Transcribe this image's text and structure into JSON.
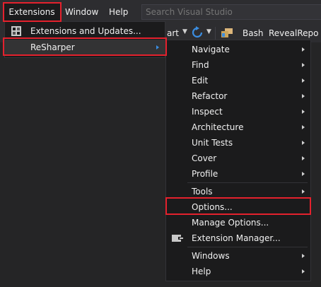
{
  "menubar": {
    "extensions": "Extensions",
    "window": "Window",
    "help": "Help",
    "search_placeholder": "Search Visual Studio"
  },
  "toolbar": {
    "partial_start": "art",
    "bash": "Bash",
    "reveal_repo": "RevealRepo"
  },
  "extensions_menu": {
    "items": [
      {
        "label": "Extensions and Updates...",
        "icon": "extensions-icon"
      },
      {
        "label": "ReSharper",
        "submenu": true
      }
    ]
  },
  "resharper_menu": {
    "items": [
      {
        "label": "Navigate",
        "submenu": true
      },
      {
        "label": "Find",
        "submenu": true
      },
      {
        "label": "Edit",
        "submenu": true
      },
      {
        "label": "Refactor",
        "submenu": true
      },
      {
        "label": "Inspect",
        "submenu": true
      },
      {
        "label": "Architecture",
        "submenu": true
      },
      {
        "label": "Unit Tests",
        "submenu": true
      },
      {
        "label": "Cover",
        "submenu": true
      },
      {
        "label": "Profile",
        "submenu": true
      },
      {
        "label": "Tools",
        "submenu": true
      },
      {
        "label": "Options..."
      },
      {
        "label": "Manage Options..."
      },
      {
        "label": "Extension Manager...",
        "icon": "extension-manager-icon"
      },
      {
        "label": "Windows",
        "submenu": true
      },
      {
        "label": "Help",
        "submenu": true
      }
    ]
  },
  "colors": {
    "highlight": "#e4212d",
    "menu_bg": "#1b1b1c",
    "chrome_bg": "#2d2d30",
    "submenu_arrow_active": "#3a8de0"
  }
}
